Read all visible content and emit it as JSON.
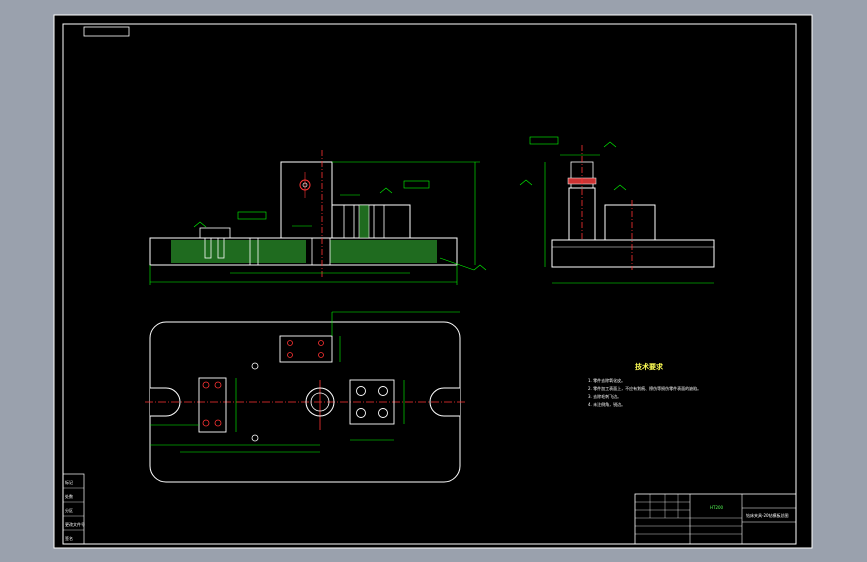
{
  "colors": {
    "window_background": "#9aa1ad",
    "drawing_background": "#000000",
    "border": "#ffffff",
    "outline": "#ffffff",
    "dimension": "#00ff00",
    "centerline": "#ff3333",
    "section_hatch": "#1f6b1f",
    "notes_title": "#ffff55"
  },
  "tech_requirements": {
    "title": "技术要求",
    "items": [
      "1. 零件去除氧化皮。",
      "2. 零件加工表面上，不应有划痕、擦伤等损伤零件表面的缺陷。",
      "3. 去除毛刺飞边。",
      "4. 未注倒角，锐边。"
    ]
  },
  "title_block": {
    "material": "HT200",
    "drawing_name": "钻床夹具-20钻模板总图",
    "left_strip": [
      "标记",
      "处数",
      "分区",
      "更改文件号",
      "签名"
    ]
  }
}
